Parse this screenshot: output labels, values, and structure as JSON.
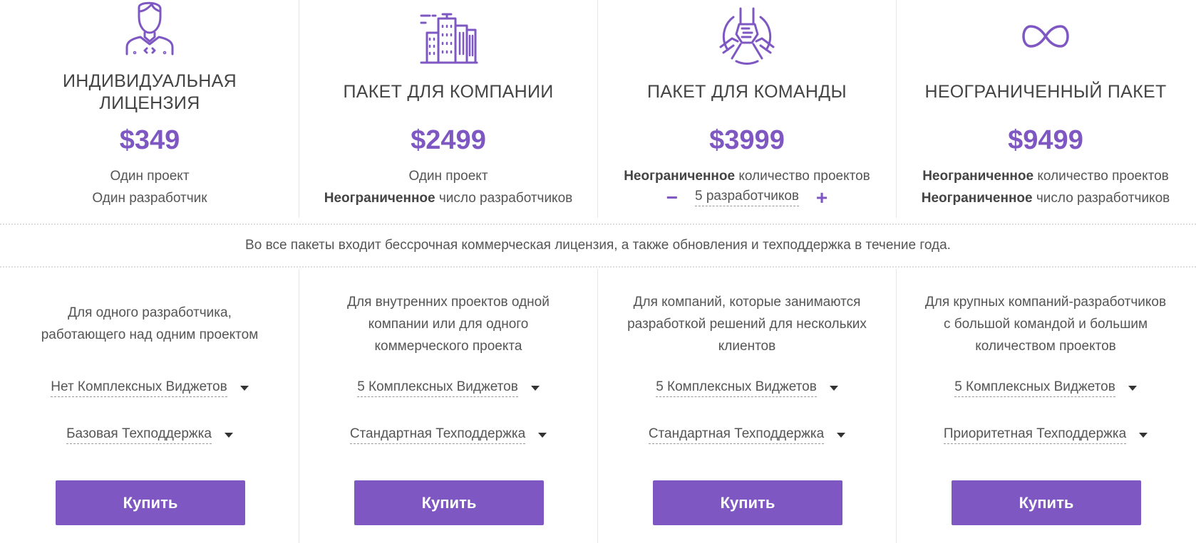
{
  "plans": [
    {
      "title_lines": [
        "ИНДИВИДУАЛЬНАЯ",
        "ЛИЦЕНЗИЯ"
      ],
      "price": "$349",
      "line1_plain": "Один проект",
      "line2_plain": "Один разработчик",
      "description_lines": [
        "Для одного разработчика,",
        "работающего над одним проектом"
      ],
      "widgets": "Нет Комплексных Виджетов",
      "support": "Базовая Техподдержка",
      "buy_label": "Купить",
      "icon": "developer-icon"
    },
    {
      "title_lines": [
        "ПАКЕТ ДЛЯ КОМПАНИИ"
      ],
      "price": "$2499",
      "line1_plain": "Один проект",
      "line2_bold": "Неограниченное",
      "line2_rest": " число разработчиков",
      "description_lines": [
        "Для внутренних проектов одной",
        "компании или для одного",
        "коммерческого проекта"
      ],
      "widgets": "5 Комплексных Виджетов",
      "support": "Стандартная Техподдержка",
      "buy_label": "Купить",
      "icon": "buildings-icon"
    },
    {
      "title_lines": [
        "ПАКЕТ ДЛЯ КОМАНДЫ"
      ],
      "price": "$3999",
      "line1_bold": "Неограниченное",
      "line1_rest": " количество проектов",
      "stepper_minus": "−",
      "stepper_value": "5 разработчиков",
      "stepper_plus": "+",
      "description_lines": [
        "Для компаний, которые занимаются",
        "разработкой решений для нескольких",
        "клиентов"
      ],
      "widgets": "5 Комплексных Виджетов",
      "support": "Стандартная Техподдержка",
      "buy_label": "Купить",
      "icon": "team-hands-icon"
    },
    {
      "title_lines": [
        "НЕОГРАНИЧЕННЫЙ ПАКЕТ"
      ],
      "price": "$9499",
      "line1_bold": "Неограниченное",
      "line1_rest": " количество проектов",
      "line2_bold": "Неограниченное",
      "line2_rest": " число разработчиков",
      "description_lines": [
        "Для крупных компаний-разработчиков",
        "с большой командой и большим",
        "количеством проектов"
      ],
      "widgets": "5 Комплексных Виджетов",
      "support": "Приоритетная Техподдержка",
      "buy_label": "Купить",
      "icon": "infinity-icon"
    }
  ],
  "notice": "Во все пакеты входит бессрочная коммерческая лицензия, а также обновления и техподдержка в течение года.",
  "colors": {
    "accent": "#7e57c2",
    "text": "#555555",
    "heading": "#444444"
  }
}
